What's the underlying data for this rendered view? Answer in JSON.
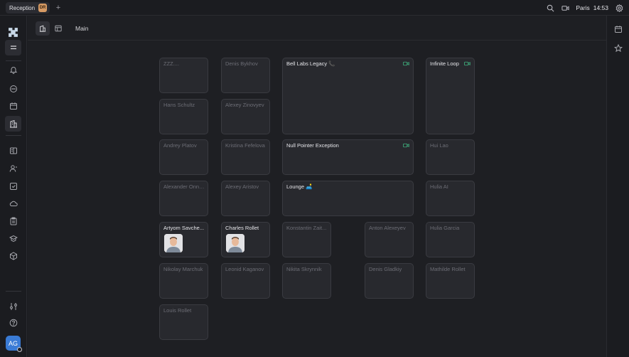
{
  "topbar": {
    "tab_label": "Reception",
    "tab_badge": "DR",
    "add_tab": "+",
    "city": "Paris",
    "time": "14:53"
  },
  "leftnav": {
    "icons": [
      "logo-icon",
      "menu-icon",
      "bell-icon",
      "chat-icon",
      "calendar-icon",
      "office-icon",
      "book-icon",
      "contacts-icon",
      "tasks-icon",
      "cloud-icon",
      "clipboard-icon",
      "education-icon",
      "box-icon",
      "settings-sliders-icon",
      "help-icon"
    ],
    "avatar_initials": "AG"
  },
  "main": {
    "floor_title": "Main",
    "rooms": [
      {
        "name": "ZZZ....",
        "lit": false
      },
      {
        "name": "Denis Bykhov",
        "lit": false
      },
      {
        "name": "Bell Labs Legacy 📞",
        "lit": true,
        "camera": true
      },
      {
        "name": "Infinite Loop",
        "lit": true,
        "camera": true
      },
      {
        "name": "Hans Schultz",
        "lit": false
      },
      {
        "name": "Alexey Zinovyev",
        "lit": false
      },
      {
        "name": "Andrey Platov",
        "lit": false
      },
      {
        "name": "Kristina Fefelova",
        "lit": false
      },
      {
        "name": "Null Pointer Exception",
        "lit": true,
        "camera": true
      },
      {
        "name": "Hui Lao",
        "lit": false
      },
      {
        "name": "Alexander Onnik...",
        "lit": false
      },
      {
        "name": "Alexey Aristov",
        "lit": false
      },
      {
        "name": "Lounge 🛋️",
        "lit": true
      },
      {
        "name": "Hulia AI",
        "lit": false
      },
      {
        "name": "Artyom Savche...",
        "lit": true,
        "person": true
      },
      {
        "name": "Charles Rollet",
        "lit": true,
        "person": true
      },
      {
        "name": "Konstantin Zait...",
        "lit": false
      },
      {
        "name": "Anton Alexeyev",
        "lit": false
      },
      {
        "name": "Hulia Garcia",
        "lit": false
      },
      {
        "name": "Nikolay Marchuk",
        "lit": false
      },
      {
        "name": "Leonid Kaganov",
        "lit": false
      },
      {
        "name": "Nikita Skrynnik",
        "lit": false
      },
      {
        "name": "Denis Gladkiy",
        "lit": false
      },
      {
        "name": "Mathilde Rollet",
        "lit": false
      },
      {
        "name": "Louis Rollet",
        "lit": false
      }
    ]
  },
  "colors": {
    "accent": "#3a7bd5",
    "camera": "#3fb27f",
    "badge": "#d79b64"
  }
}
